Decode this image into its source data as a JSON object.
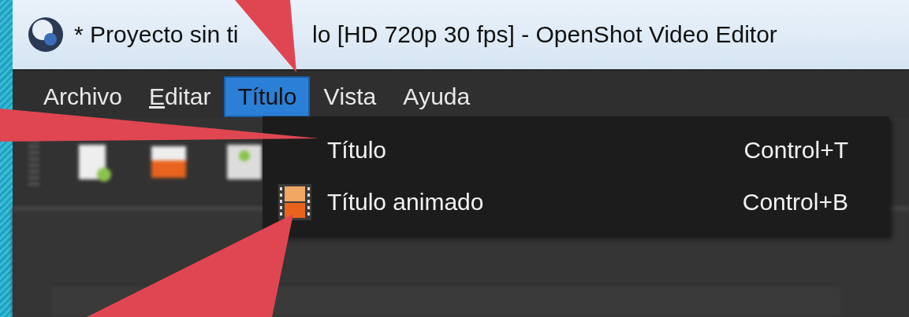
{
  "window": {
    "title_parts": [
      "* Proyecto sin ti",
      "lo [HD 720p 30 fps] - OpenShot Video Editor"
    ]
  },
  "menu_bar": [
    {
      "label": "Archivo",
      "selected": false,
      "mnemonic": false
    },
    {
      "label": "Editar",
      "selected": false,
      "mnemonic": true
    },
    {
      "label": "Título",
      "selected": true,
      "mnemonic": false
    },
    {
      "label": "Vista",
      "selected": false,
      "mnemonic": false
    },
    {
      "label": "Ayuda",
      "selected": false,
      "mnemonic": false
    }
  ],
  "dropdown": [
    {
      "label": "Título",
      "shortcut": "Control+T",
      "kind": "plain"
    },
    {
      "label": "Título animado",
      "shortcut": "Control+B",
      "kind": "film"
    }
  ]
}
